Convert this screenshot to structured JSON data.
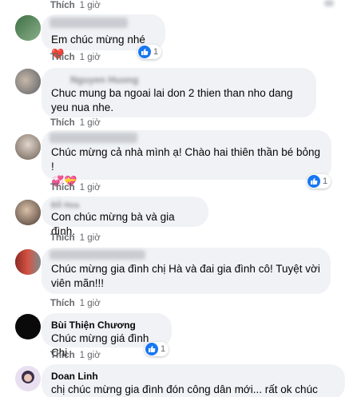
{
  "labels": {
    "like": "Thích"
  },
  "comments": [
    {
      "author": "",
      "text": "",
      "time": "1 giờ",
      "reactions": ""
    },
    {
      "author": "",
      "text": "Em chúc mừng nhé",
      "emoji": "❤️",
      "time": "1 giờ",
      "reactions": "1"
    },
    {
      "author": "Nguyen Huong",
      "text": "Chuc mung ba ngoai lai don 2 thien than nho dang yeu nua nhe.",
      "time": "1 giờ",
      "reactions": ""
    },
    {
      "author": "",
      "text": "Chúc mừng cả nhà mình ạ! Chào hai thiên thần bé bỏng !",
      "emoji": "💞💝",
      "time": "1 giờ",
      "reactions": "1"
    },
    {
      "author": "Đỗ Hoa",
      "text": "Con chúc mừng bà và gia đình.",
      "time": "1 giờ",
      "reactions": ""
    },
    {
      "author": "",
      "text": "Chúc mừng gia đình chị Hà và đai gia đình cô! Tuyệt vời viên mãn!!!",
      "time": "1 giờ",
      "reactions": ""
    },
    {
      "author": "Bùi Thiện Chương",
      "text": "Chúc mừng giá đình Chị",
      "time": "1 giờ",
      "reactions": "1"
    },
    {
      "author": "Doan Linh",
      "text": "chị chúc mừng gia đình đón công dân mới... rất ok chúc",
      "time": "",
      "reactions": ""
    }
  ],
  "colors": {
    "bubble": "#f0f2f5",
    "like_blue": "#1877f2",
    "meta": "#65676b"
  }
}
